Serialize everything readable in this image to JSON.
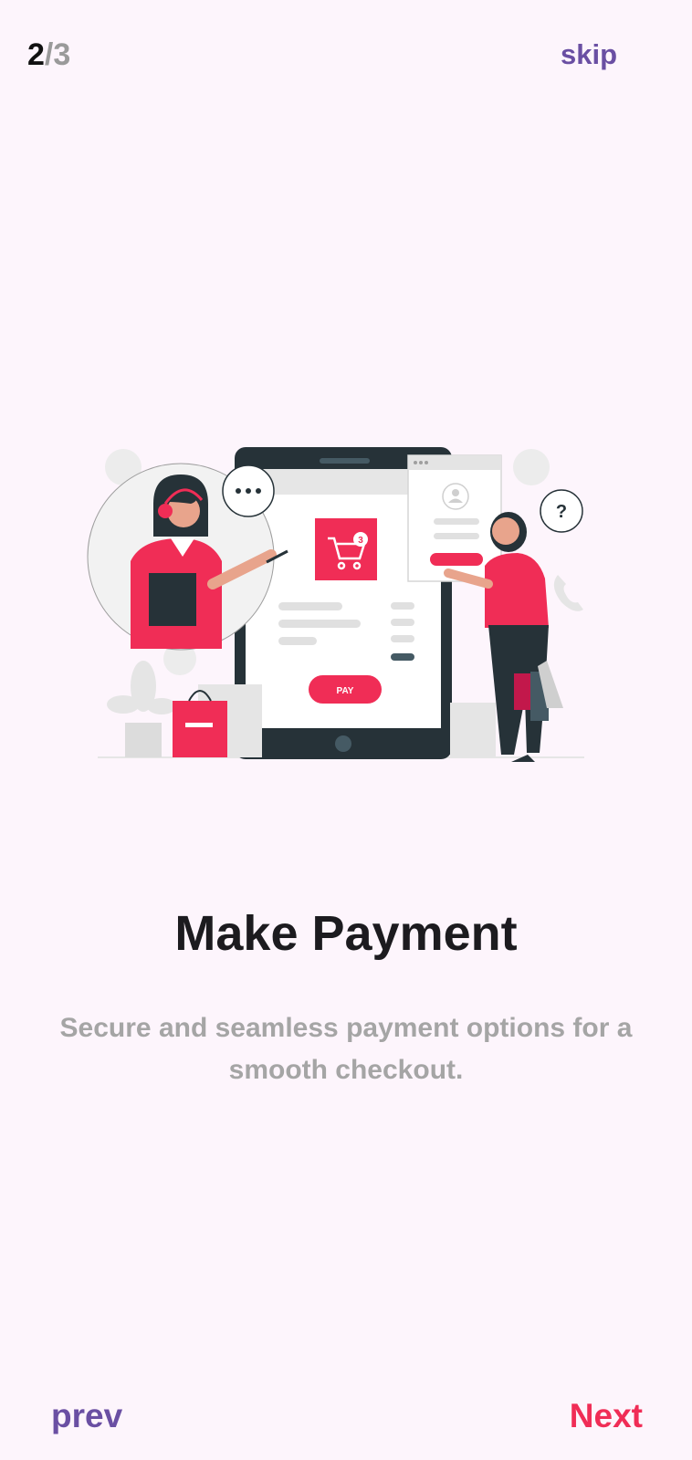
{
  "pager": {
    "current": "2",
    "separator": "/",
    "total": "3"
  },
  "header": {
    "skip_label": "skip"
  },
  "illustration": {
    "pay_label": "PAY",
    "cart_badge": "3",
    "question_mark": "?"
  },
  "content": {
    "title": "Make Payment",
    "subtitle": "Secure and seamless payment options for a smooth checkout."
  },
  "footer": {
    "prev_label": "prev",
    "next_label": "Next"
  },
  "colors": {
    "accent": "#f02d56",
    "brand": "#6a4fa3",
    "background": "#fdf5fc"
  }
}
